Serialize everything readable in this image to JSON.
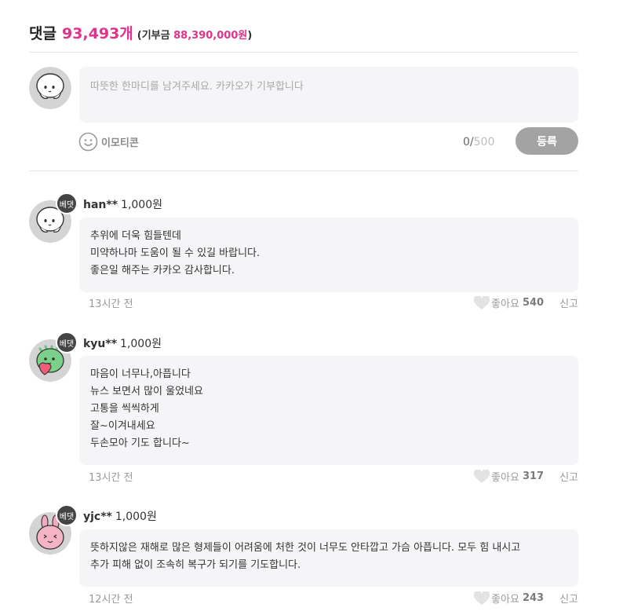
{
  "header": {
    "label": "댓글",
    "count": "93,493개",
    "donate_prefix": "(기부금 ",
    "donate_amount": "88,390,000원",
    "donate_suffix": ")"
  },
  "composer": {
    "placeholder": "따뜻한 한마디를 남겨주세요. 카카오가 기부합니다",
    "emoticon_label": "이모티콘",
    "char_count": "0",
    "char_sep": "/",
    "char_max": "500",
    "submit_label": "등록"
  },
  "comments": [
    {
      "badge": "베댓",
      "user": "han**",
      "amount": "1,000원",
      "lines": [
        "추위에 더욱 힘들텐데",
        "미약하나마 도움이 될 수 있길 바랍니다.",
        "좋은일 해주는 카카오 감사합니다."
      ],
      "time": "13시간 전",
      "like_label": "좋아요",
      "likes": "540",
      "report_label": "신고"
    },
    {
      "badge": "베댓",
      "user": "kyu**",
      "amount": "1,000원",
      "lines": [
        "마음이 너무나,아픕니다",
        "뉴스 보면서 많이 울었네요",
        "고통을 씩씩하게",
        "잘~이겨내세요",
        "두손모아 기도 합니다~"
      ],
      "time": "13시간 전",
      "like_label": "좋아요",
      "likes": "317",
      "report_label": "신고"
    },
    {
      "badge": "베댓",
      "user": "yjc**",
      "amount": "1,000원",
      "lines": [
        "뜻하지않은 재해로 많은 형제들이 어려움에 처한 것이 너무도 안타깝고 가슴 아픕니다. 모두 힘 내시고",
        "추가 피해 없이 조속히 복구가 되기를 기도합니다."
      ],
      "time": "12시간 전",
      "like_label": "좋아요",
      "likes": "243",
      "report_label": "신고"
    }
  ],
  "colors": {
    "accent": "#e0338a",
    "bubble_bg": "#f5f5f7",
    "submit_bg": "#a3a3a3",
    "badge_bg": "#444444"
  },
  "icons": [
    "user-avatar-icon",
    "emoticon-smile-icon",
    "heart-icon"
  ]
}
